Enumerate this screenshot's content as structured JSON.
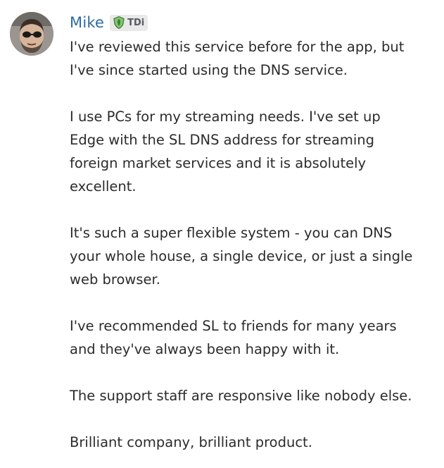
{
  "author": {
    "name": "Mike",
    "badge": {
      "icon": "leaf-shield-icon",
      "text": "TDi",
      "color": "#58a14e"
    },
    "avatar": "avatar"
  },
  "message": {
    "paragraphs": [
      [
        "I've reviewed this service before for the app, but",
        "I've since started using the DNS service."
      ],
      [
        "I use PCs for my streaming needs. I've set up",
        "Edge with the SL DNS address for streaming",
        "foreign market services and it is absolutely",
        "excellent."
      ],
      [
        "It's such a super flexible system - you can DNS",
        "your whole house, a single device, or just a single",
        "web browser."
      ],
      [
        "I've recommended SL to friends for many years",
        "and they've always been happy with it."
      ],
      [
        "The support staff are responsive like nobody else."
      ],
      [
        "Brilliant company, brilliant product."
      ]
    ]
  },
  "colors": {
    "username": "#2d6ca2",
    "text": "#2b2b2b",
    "badge_bg": "#e9e9e9"
  }
}
